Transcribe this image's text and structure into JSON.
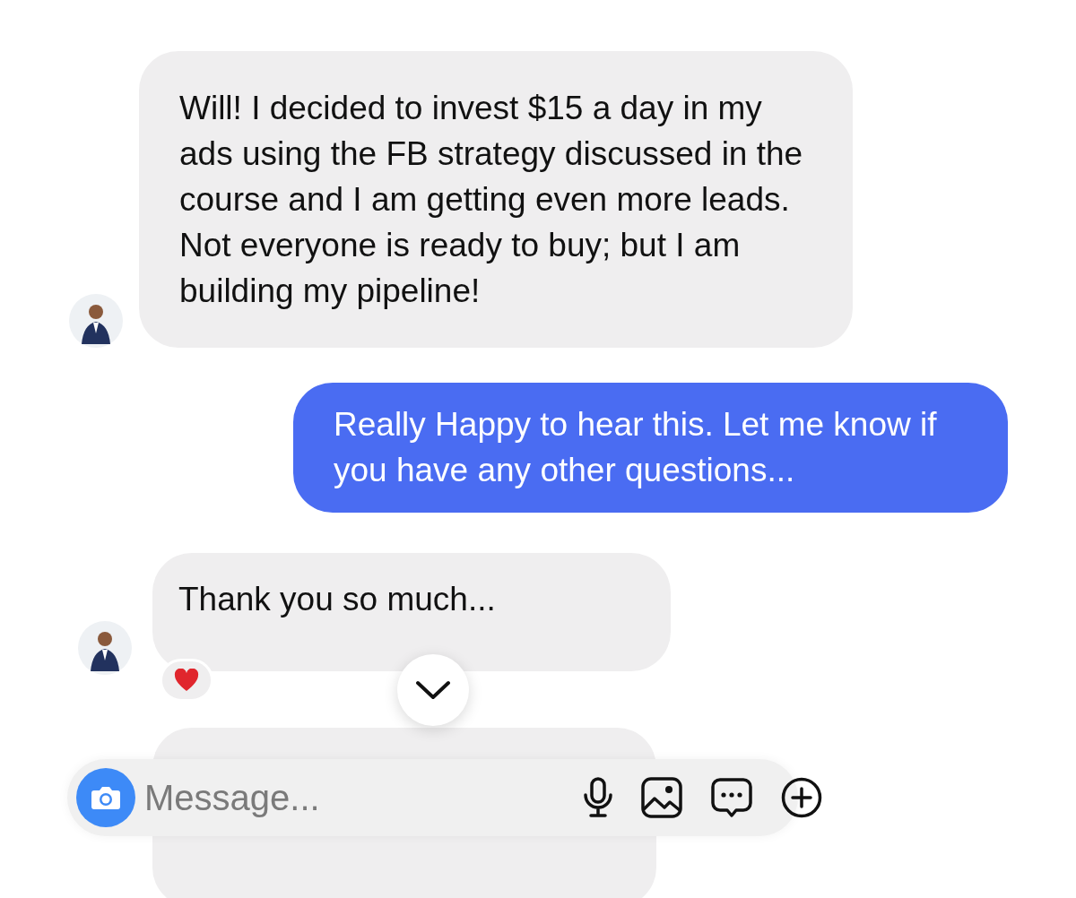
{
  "messages": [
    {
      "kind": "incoming",
      "text": "Will! I decided to invest $15 a day in my ads using the FB strategy discussed in the course and I am getting even more leads. Not everyone is ready to buy; but I am building my pipeline!",
      "avatar": true,
      "reacted": false
    },
    {
      "kind": "outgoing",
      "text": "Really Happy to hear this. Let me know if you have any other questions...",
      "avatar": false,
      "reacted": false
    },
    {
      "kind": "incoming",
      "text": "Thank you so much...",
      "avatar": true,
      "reacted": true
    },
    {
      "kind": "incoming",
      "avatar": false,
      "reacted": false
    }
  ],
  "composer": {
    "placeholder": "Message..."
  }
}
